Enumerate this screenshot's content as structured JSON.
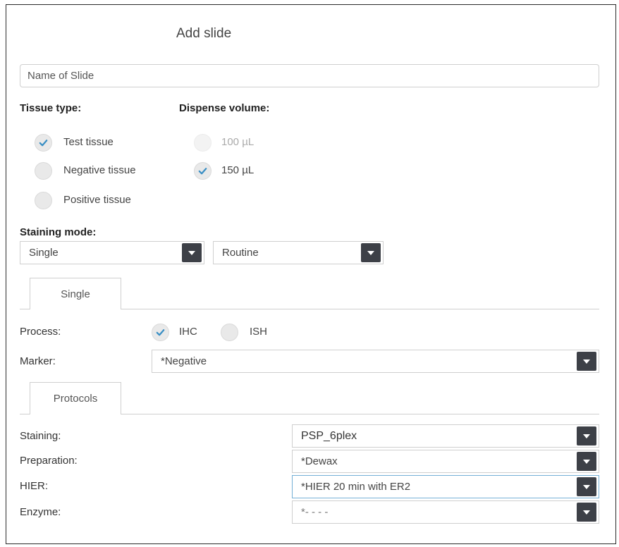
{
  "dialog": {
    "title": "Add slide",
    "name_placeholder": "Name of Slide"
  },
  "tissue_type": {
    "label": "Tissue type:",
    "options": [
      {
        "label": "Test tissue",
        "checked": true
      },
      {
        "label": "Negative tissue",
        "checked": false
      },
      {
        "label": "Positive tissue",
        "checked": false
      }
    ]
  },
  "dispense_volume": {
    "label": "Dispense volume:",
    "options": [
      {
        "label": "100 µL",
        "checked": false,
        "disabled": true
      },
      {
        "label": "150 µL",
        "checked": true,
        "disabled": false
      }
    ]
  },
  "staining_mode": {
    "label": "Staining mode:",
    "mode_value": "Single",
    "type_value": "Routine"
  },
  "tabs": {
    "single": "Single",
    "protocols": "Protocols"
  },
  "process": {
    "label": "Process:",
    "options": [
      {
        "label": "IHC",
        "checked": true
      },
      {
        "label": "ISH",
        "checked": false
      }
    ]
  },
  "marker": {
    "label": "Marker:",
    "value": "*Negative"
  },
  "protocols": {
    "staining": {
      "label": "Staining:",
      "value": "PSP_6plex"
    },
    "preparation": {
      "label": "Preparation:",
      "value": "*Dewax"
    },
    "hier": {
      "label": "HIER:",
      "value": "*HIER 20 min with ER2"
    },
    "enzyme": {
      "label": "Enzyme:",
      "value": "*- - - -"
    }
  },
  "colors": {
    "check": "#3a8fc4",
    "dropdown_button": "#3d4047",
    "focus_border": "#74b0d6"
  }
}
